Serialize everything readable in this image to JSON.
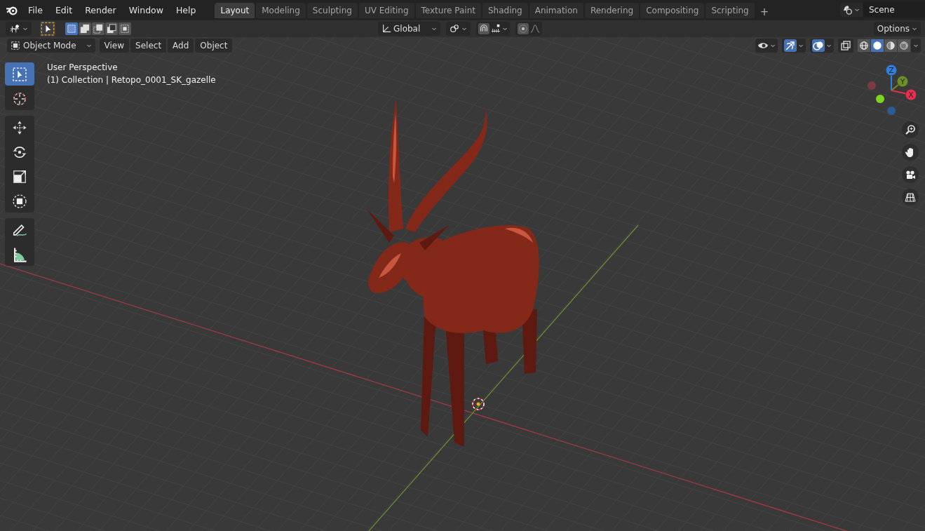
{
  "menu": [
    {
      "label": "File"
    },
    {
      "label": "Edit"
    },
    {
      "label": "Render"
    },
    {
      "label": "Window"
    },
    {
      "label": "Help"
    }
  ],
  "workspaces": [
    {
      "label": "Layout",
      "selected": true
    },
    {
      "label": "Modeling",
      "selected": false
    },
    {
      "label": "Sculpting",
      "selected": false
    },
    {
      "label": "UV Editing",
      "selected": false
    },
    {
      "label": "Texture Paint",
      "selected": false
    },
    {
      "label": "Shading",
      "selected": false
    },
    {
      "label": "Animation",
      "selected": false
    },
    {
      "label": "Rendering",
      "selected": false
    },
    {
      "label": "Compositing",
      "selected": false
    },
    {
      "label": "Scripting",
      "selected": false
    }
  ],
  "add_workspace": "+",
  "scene": "Scene",
  "tool_header": {
    "selection_modes": [
      {
        "selected": true
      },
      {
        "selected": false
      },
      {
        "selected": false
      },
      {
        "selected": false
      },
      {
        "selected": false
      }
    ],
    "orientation": "Global",
    "options": "Options"
  },
  "viewport_header": {
    "mode": "Object Mode",
    "menus": [
      "View",
      "Select",
      "Add",
      "Object"
    ],
    "gizmos_on": true,
    "overlays_on": true,
    "xray_on": false,
    "shading": [
      {
        "kind": "wireframe",
        "selected": false
      },
      {
        "kind": "solid",
        "selected": true
      },
      {
        "kind": "material",
        "selected": false
      },
      {
        "kind": "rendered",
        "selected": false
      }
    ]
  },
  "viewport": {
    "title": "User Perspective",
    "collection": "(1) Collection | Retopo_0001_SK_gazelle"
  },
  "toolbar": [
    [
      {
        "kind": "select",
        "selected": true
      },
      {
        "kind": "cursor",
        "selected": false
      }
    ],
    [
      {
        "kind": "move",
        "selected": false
      },
      {
        "kind": "rotate",
        "selected": false
      },
      {
        "kind": "scale",
        "selected": false
      },
      {
        "kind": "transform",
        "selected": false
      }
    ],
    [
      {
        "kind": "annotate",
        "selected": false
      },
      {
        "kind": "measure",
        "selected": false
      }
    ]
  ],
  "gizmo": {
    "axes": [
      {
        "label": "Z",
        "color": "#2f7fdc"
      },
      {
        "label": "Y",
        "color": "#6e8f24"
      },
      {
        "label": "X",
        "color": "#e8304e"
      }
    ]
  },
  "navigation": [
    {
      "kind": "zoom"
    },
    {
      "kind": "pan"
    },
    {
      "kind": "camera"
    },
    {
      "kind": "ortho"
    }
  ]
}
